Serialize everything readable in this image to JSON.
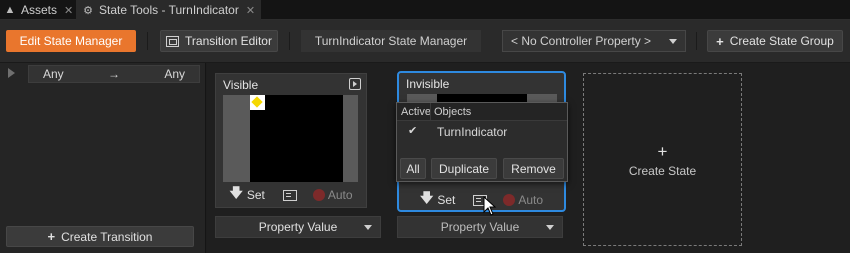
{
  "tabs": [
    {
      "label": "Assets",
      "icon": "assets-icon"
    },
    {
      "label": "State Tools - TurnIndicator",
      "icon": "gear-icon"
    }
  ],
  "toolbar": {
    "edit_state_manager": "Edit State Manager",
    "transition_editor": "Transition Editor",
    "state_manager_name": "TurnIndicator State Manager",
    "controller_property": "< No Controller Property >",
    "create_state_group": "Create State Group"
  },
  "transitions": {
    "from": "Any",
    "arrow": "→",
    "to": "Any",
    "create_transition": "Create Transition"
  },
  "states": [
    {
      "title": "Visible",
      "set": "Set",
      "auto": "Auto",
      "property_value": "Property Value"
    },
    {
      "title": "Invisible",
      "set": "Set",
      "auto": "Auto",
      "property_value": "Property Value"
    }
  ],
  "create_state": {
    "plus": "+",
    "label": "Create State"
  },
  "popup": {
    "col_active": "Active",
    "col_objects": "Objects",
    "row_check": "✔",
    "row_object": "TurnIndicator",
    "all": "All",
    "duplicate": "Duplicate",
    "remove": "Remove"
  },
  "colors": {
    "accent_orange": "#e9762d",
    "selection_blue": "#2e8ae0",
    "indicator_yellow": "#f5d800"
  }
}
